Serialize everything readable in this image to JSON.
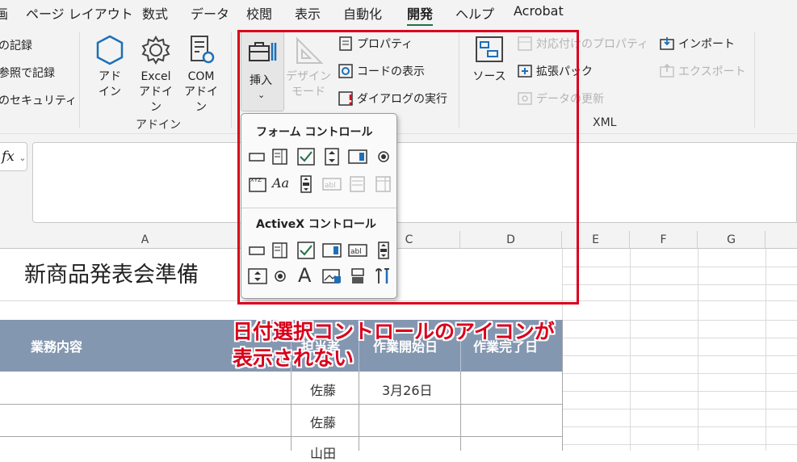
{
  "tabs": [
    "画",
    "ページ レイアウト",
    "数式",
    "データ",
    "校閲",
    "表示",
    "自動化",
    "開発",
    "ヘルプ",
    "Acrobat"
  ],
  "macros": {
    "record": "の記録",
    "relative": "参照で記録",
    "security": "のセキュリティ"
  },
  "addins": {
    "addin_label1": "アド",
    "addin_label2": "イン",
    "excel1": "Excel",
    "excel2": "アドイン",
    "com1": "COM",
    "com2": "アドイン",
    "group": "アドイン"
  },
  "controls": {
    "insert": "挿入",
    "design1": "デザイン",
    "design2": "モード",
    "properties": "プロパティ",
    "view_code": "コードの表示",
    "run_dialog": "ダイアログの実行"
  },
  "xml": {
    "source": "ソース",
    "map_props": "対応付けのプロパティ",
    "expansion": "拡張パック",
    "refresh": "データの更新",
    "import": "インポート",
    "export": "エクスポート",
    "group": "XML"
  },
  "formula": {
    "fx": "fx"
  },
  "dropdown": {
    "form_controls": "フォーム コントロール",
    "activex_controls": "ActiveX コントロール"
  },
  "columns": [
    "A",
    "C",
    "D",
    "E",
    "F",
    "G"
  ],
  "sheet": {
    "title": "新商品発表会準備",
    "headers": [
      "業務内容",
      "担当者",
      "作業開始日",
      "作業完了日"
    ],
    "rows": [
      {
        "person": "佐藤",
        "start": "3月26日"
      },
      {
        "person": "佐藤",
        "start": ""
      },
      {
        "person": "山田",
        "start": ""
      }
    ]
  },
  "annotation": {
    "line1": "日付選択コントロールのアイコンが",
    "line2": "表示されない",
    "color": "#d9001b"
  }
}
